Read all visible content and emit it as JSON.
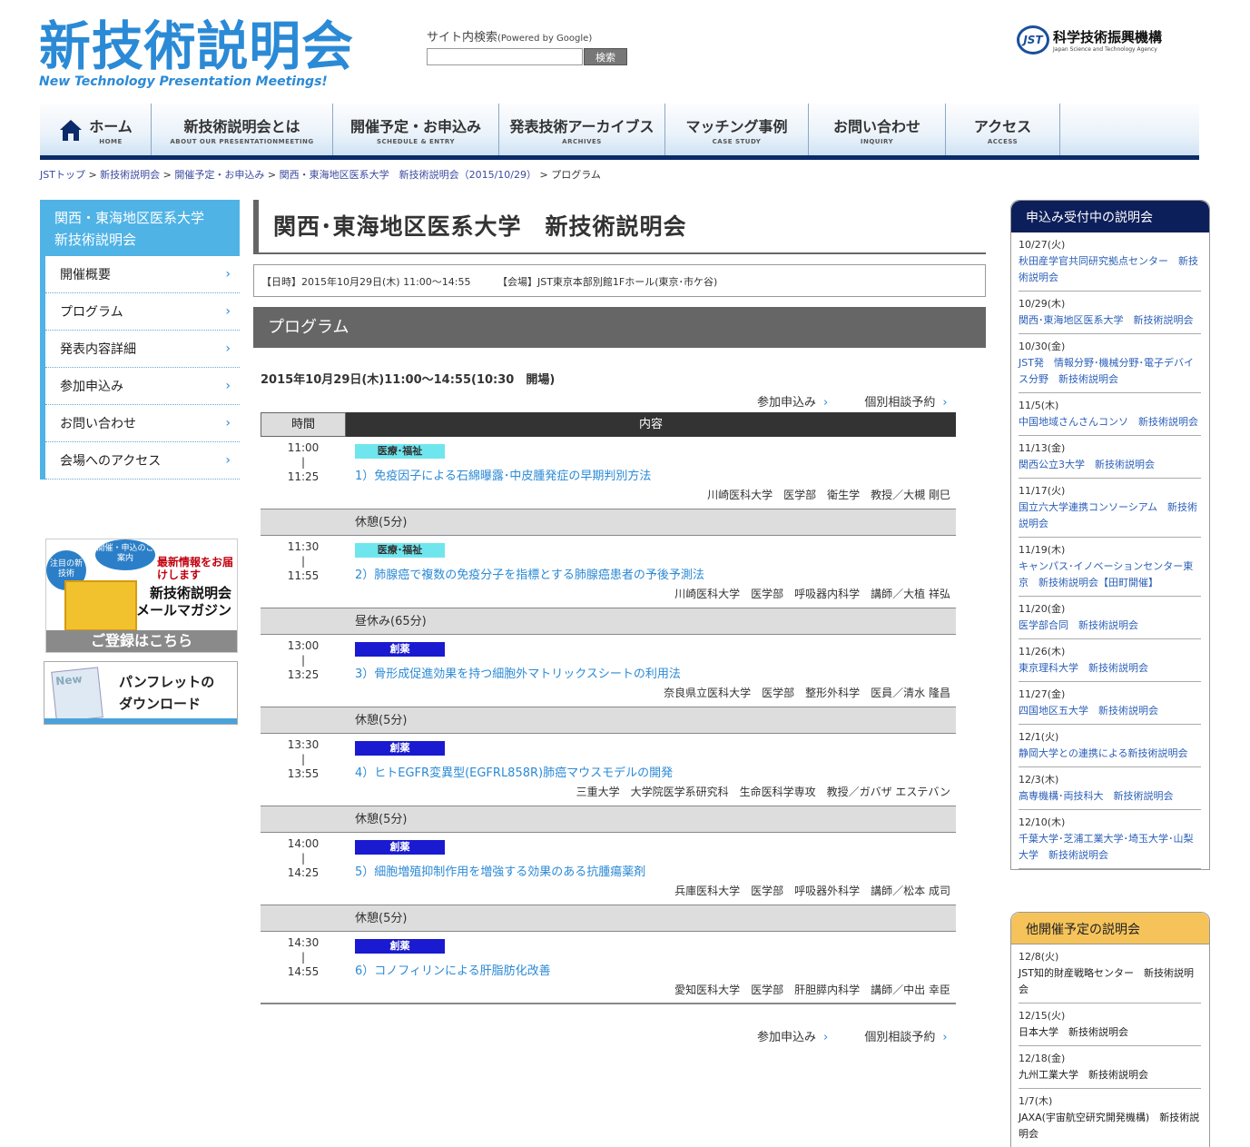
{
  "logo": {
    "jp": "新技術説明会",
    "en": "New Technology Presentation Meetings!"
  },
  "search": {
    "label": "サイト内検索",
    "powered": "(Powered by Google)",
    "button": "検索",
    "value": ""
  },
  "jst": {
    "mark": "JST",
    "name": "科学技術振興機構",
    "sub": "Japan Science and Technology Agency"
  },
  "nav": [
    {
      "jp": "ホーム",
      "en": "HOME"
    },
    {
      "jp": "新技術説明会とは",
      "en": "ABOUT OUR PRESENTATIONMEETING"
    },
    {
      "jp": "開催予定・お申込み",
      "en": "SCHEDULE & ENTRY"
    },
    {
      "jp": "発表技術アーカイブス",
      "en": "ARCHIVES"
    },
    {
      "jp": "マッチング事例",
      "en": "CASE STUDY"
    },
    {
      "jp": "お問い合わせ",
      "en": "INQUIRY"
    },
    {
      "jp": "アクセス",
      "en": "ACCESS"
    }
  ],
  "breadcrumb": [
    "JSTトップ",
    "新技術説明会",
    "開催予定・お申込み",
    "関西・東海地区医系大学　新技術説明会（2015/10/29）",
    "プログラム"
  ],
  "sidebar": {
    "title": "関西・東海地区医系大学新技術説明会",
    "title_l1": "関西・東海地区医系大学",
    "title_l2": "新技術説明会",
    "items": [
      "開催概要",
      "プログラム",
      "発表内容詳細",
      "参加申込み",
      "お問い合わせ",
      "会場へのアクセス"
    ]
  },
  "mail_banner": {
    "b1": "注目の新技術",
    "b2": "開催・申込のご案内",
    "r1": "最新情報をお届けします",
    "r2a": "新技術説明会",
    "r2b": "メールマガジン",
    "bottom": "ご登録はこちら"
  },
  "pamphlet": {
    "icon_text": "New",
    "l1": "パンフレットの",
    "l2": "ダウンロード"
  },
  "main": {
    "title": "関西･東海地区医系大学　新技術説明会",
    "date": "【日時】2015年10月29日(木) 11:00～14:55",
    "venue": "【会場】JST東京本部別館1Fホール(東京･市ケ谷)",
    "program_heading": "プログラム",
    "date_line": "2015年10月29日(木)11:00～14:55(10:30　開場)",
    "link_apply": "参加申込み",
    "link_consult": "個別相談予約",
    "col_time": "時間",
    "col_content": "内容"
  },
  "sessions": [
    {
      "start": "11:00",
      "end": "11:25",
      "tag": "医療･福祉",
      "tagtype": "med",
      "title": "1）免疫因子による石綿曝露･中皮腫発症の早期判別方法",
      "affil": "川崎医科大学　医学部　衛生学　教授／大槻 剛巳",
      "break": "休憩(5分)"
    },
    {
      "start": "11:30",
      "end": "11:55",
      "tag": "医療･福祉",
      "tagtype": "med",
      "title": "2）肺腺癌で複数の免疫分子を指標とする肺腺癌患者の予後予測法",
      "affil": "川崎医科大学　医学部　呼吸器内科学　講師／大植 祥弘",
      "break": "昼休み(65分)"
    },
    {
      "start": "13:00",
      "end": "13:25",
      "tag": "創薬",
      "tagtype": "sou",
      "title": "3）骨形成促進効果を持つ細胞外マトリックスシートの利用法",
      "affil": "奈良県立医科大学　医学部　整形外科学　医員／清水 隆昌",
      "break": "休憩(5分)"
    },
    {
      "start": "13:30",
      "end": "13:55",
      "tag": "創薬",
      "tagtype": "sou",
      "title": "4）ヒトEGFR変異型(EGFRL858R)肺癌マウスモデルの開発",
      "affil": "三重大学　大学院医学系研究科　生命医科学専攻　教授／ガバザ エステバン",
      "break": "休憩(5分)"
    },
    {
      "start": "14:00",
      "end": "14:25",
      "tag": "創薬",
      "tagtype": "sou",
      "title": "5）細胞増殖抑制作用を増強する効果のある抗腫瘍薬剤",
      "affil": "兵庫医科大学　医学部　呼吸器外科学　講師／松本 成司",
      "break": "休憩(5分)"
    },
    {
      "start": "14:30",
      "end": "14:55",
      "tag": "創薬",
      "tagtype": "sou",
      "title": "6）コノフィリンによる肝脂肪化改善",
      "affil": "愛知医科大学　医学部　肝胆膵内科学　講師／中出 幸臣",
      "break": ""
    }
  ],
  "open_events": {
    "heading": "申込み受付中の説明会",
    "items": [
      {
        "date": "10/27(火)",
        "name": "秋田産学官共同研究拠点センター　新技術説明会"
      },
      {
        "date": "10/29(木)",
        "name": "関西･東海地区医系大学　新技術説明会"
      },
      {
        "date": "10/30(金)",
        "name": "JST発　情報分野･機械分野･電子デバイス分野　新技術説明会"
      },
      {
        "date": "11/5(木)",
        "name": "中国地域さんさんコンソ　新技術説明会"
      },
      {
        "date": "11/13(金)",
        "name": "関西公立3大学　新技術説明会"
      },
      {
        "date": "11/17(火)",
        "name": "国立六大学連携コンソーシアム　新技術説明会"
      },
      {
        "date": "11/19(木)",
        "name": "キャンパス･イノベーションセンター東京　新技術説明会【田町開催】"
      },
      {
        "date": "11/20(金)",
        "name": "医学部合同　新技術説明会"
      },
      {
        "date": "11/26(木)",
        "name": "東京理科大学　新技術説明会"
      },
      {
        "date": "11/27(金)",
        "name": "四国地区五大学　新技術説明会"
      },
      {
        "date": "12/1(火)",
        "name": "静岡大学との連携による新技術説明会"
      },
      {
        "date": "12/3(木)",
        "name": "高専機構･両技科大　新技術説明会"
      },
      {
        "date": "12/10(木)",
        "name": "千葉大学･芝浦工業大学･埼玉大学･山梨大学　新技術説明会"
      }
    ]
  },
  "other_events": {
    "heading": "他開催予定の説明会",
    "items": [
      {
        "date": "12/8(火)",
        "name": "JST知的財産戦略センター　新技術説明会"
      },
      {
        "date": "12/15(火)",
        "name": "日本大学　新技術説明会"
      },
      {
        "date": "12/18(金)",
        "name": "九州工業大学　新技術説明会"
      },
      {
        "date": "1/7(木)",
        "name": "JAXA(宇宙航空研究開発機構)　新技術説明会"
      }
    ]
  }
}
